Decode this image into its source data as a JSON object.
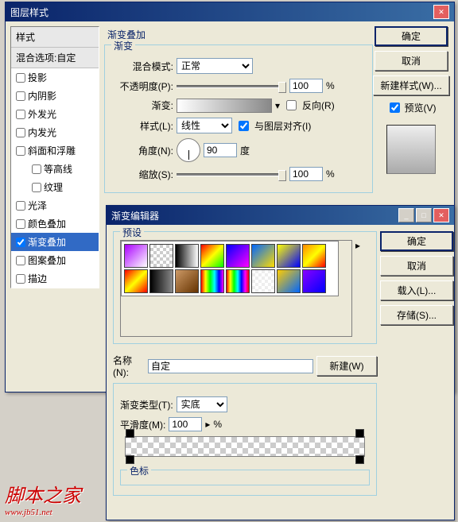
{
  "dlg1": {
    "title": "图层样式",
    "sidebar": {
      "hdr1": "样式",
      "hdr2": "混合选项:自定",
      "items": [
        "投影",
        "内阴影",
        "外发光",
        "内发光",
        "斜面和浮雕",
        "等高线",
        "纹理",
        "光泽",
        "颜色叠加",
        "渐变叠加",
        "图案叠加",
        "描边"
      ],
      "checked": [
        false,
        false,
        false,
        false,
        false,
        false,
        false,
        false,
        false,
        true,
        false,
        false
      ]
    },
    "panel_title": "渐变叠加",
    "grad_group": "渐变",
    "blend_label": "混合模式:",
    "blend_value": "正常",
    "opacity_label": "不透明度(P):",
    "opacity_value": "100",
    "pct": "%",
    "grad_label": "渐变:",
    "reverse": "反向(R)",
    "style_label": "样式(L):",
    "style_value": "线性",
    "align": "与图层对齐(I)",
    "angle_label": "角度(N):",
    "angle_value": "90",
    "degree": "度",
    "scale_label": "缩放(S):",
    "scale_value": "100",
    "btns": {
      "ok": "确定",
      "cancel": "取消",
      "newstyle": "新建样式(W)...",
      "preview": "预览(V)"
    }
  },
  "dlg2": {
    "title": "渐变编辑器",
    "presets_label": "预设",
    "btns": {
      "ok": "确定",
      "cancel": "取消",
      "load": "载入(L)...",
      "save": "存储(S)..."
    },
    "name_label": "名称(N):",
    "name_value": "自定",
    "new_btn": "新建(W)",
    "gtype_label": "渐变类型(T):",
    "gtype_value": "实底",
    "smooth_label": "平滑度(M):",
    "smooth_value": "100",
    "pct": "%",
    "stops_label": "色标",
    "swatches": [
      "linear-gradient(135deg,#a0f,#fff)",
      "repeating-conic-gradient(#ccc 0 25%,#fff 0 50%)",
      "linear-gradient(to right,#000,#fff)",
      "linear-gradient(135deg,#f00,#ff0,#0f0)",
      "linear-gradient(135deg,#00f,#f0f)",
      "linear-gradient(135deg,#06f,#fd0)",
      "linear-gradient(135deg,#ff0,#00f)",
      "linear-gradient(135deg,#f80,#ff0,#f00)",
      "linear-gradient(135deg,#f00,#ff0,#f00)",
      "linear-gradient(to right,#000,#888)",
      "linear-gradient(135deg,#c96,#630)",
      "linear-gradient(to right,#f00,#ff0,#0f0,#0ff,#00f,#f0f)",
      "linear-gradient(to right,#f00,#ff0,#0f0,#0ff,#00f,#f0f,#f00)",
      "repeating-conic-gradient(#eee 0 25%,#fff 0 50%)",
      "linear-gradient(135deg,#fc0,#06f)",
      "linear-gradient(135deg,#80f,#00f)"
    ]
  },
  "watermark": {
    "text": "脚本之家",
    "url": "www.jb51.net"
  }
}
